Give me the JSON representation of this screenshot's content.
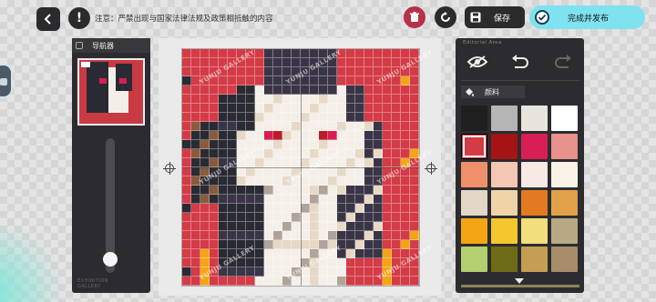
{
  "topbar": {
    "notice": "注意：严禁出现与国家法律法规及政策相抵触的内容",
    "save_label": "保存",
    "finish_label": "完成并发布"
  },
  "navigator": {
    "title": "导航器",
    "zoom_fraction": 0.05,
    "logo_line1": "EXHIBITION",
    "logo_line2": "GALLERY"
  },
  "editor_panel": {
    "header": "Editorial Area",
    "palette_tab": "颜料",
    "selected_index": 4,
    "swatches": [
      "#1f1f1f",
      "#b5b5b5",
      "#e8e6dc",
      "#ffffff",
      "#d33b46",
      "#a41414",
      "#d81e55",
      "#e7928d",
      "#f0906a",
      "#f3c7b2",
      "#f7e9e4",
      "#faf2e6",
      "#e3d7c8",
      "#f0d4a8",
      "#e37a21",
      "#e3a04b",
      "#f3a514",
      "#f6c62e",
      "#f2de7b",
      "#b7a984",
      "#b3cf6e",
      "#6f6c18",
      "#c49f53",
      "#a88d69"
    ]
  },
  "canvas": {
    "watermark": "YUNJU GALLERY"
  },
  "colors": {
    "accent": "#7fe3ef",
    "danger": "#c0314a",
    "panel": "#2c2c30"
  }
}
